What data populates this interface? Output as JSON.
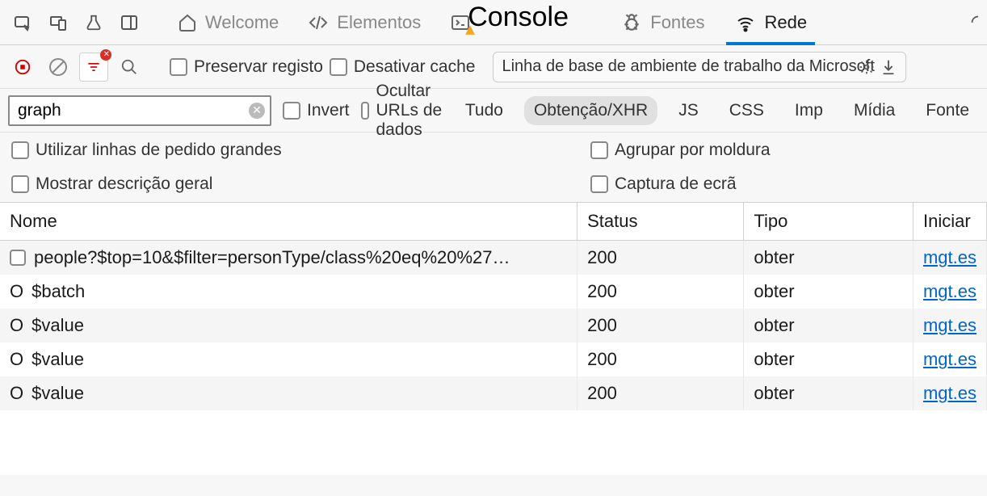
{
  "top_tabs": {
    "welcome": "Welcome",
    "elements": "Elementos",
    "console": "Console",
    "sources": "Fontes",
    "network": "Rede"
  },
  "toolbar": {
    "preserve_log": "Preservar registo",
    "disable_cache": "Desativar cache",
    "throttling": "Linha de base de ambiente de trabalho da Microsoft"
  },
  "filter": {
    "value": "graph",
    "invert": "Invert",
    "hide_data_urls": "Ocultar URLs de dados",
    "types": {
      "all": "Tudo",
      "fetch_xhr": "Obtenção/XHR",
      "js": "JS",
      "css": "CSS",
      "img": "Imp",
      "media": "Mídia",
      "font": "Fonte"
    }
  },
  "options": {
    "large_rows": "Utilizar linhas de pedido grandes",
    "show_overview": "Mostrar descrição geral",
    "group_by_frame": "Agrupar por moldura",
    "screenshots": "Captura de ecrã"
  },
  "table": {
    "headers": {
      "name": "Nome",
      "status": "Status",
      "type": "Tipo",
      "initiator": "Iniciar"
    },
    "rows": [
      {
        "icon": "checkbox",
        "name": "people?$top=10&$filter=personType/class%20eq%20%27…",
        "status": "200",
        "type": "obter",
        "initiator": "mgt.es"
      },
      {
        "icon": "circle",
        "name": "$batch",
        "status": "200",
        "type": "obter",
        "initiator": "mgt.es"
      },
      {
        "icon": "circle",
        "name": "$value",
        "status": "200",
        "type": "obter",
        "initiator": "mgt.es"
      },
      {
        "icon": "circle",
        "name": "$value",
        "status": "200",
        "type": "obter",
        "initiator": "mgt.es"
      },
      {
        "icon": "circle",
        "name": "$value",
        "status": "200",
        "type": "obter",
        "initiator": "mgt.es"
      }
    ]
  }
}
